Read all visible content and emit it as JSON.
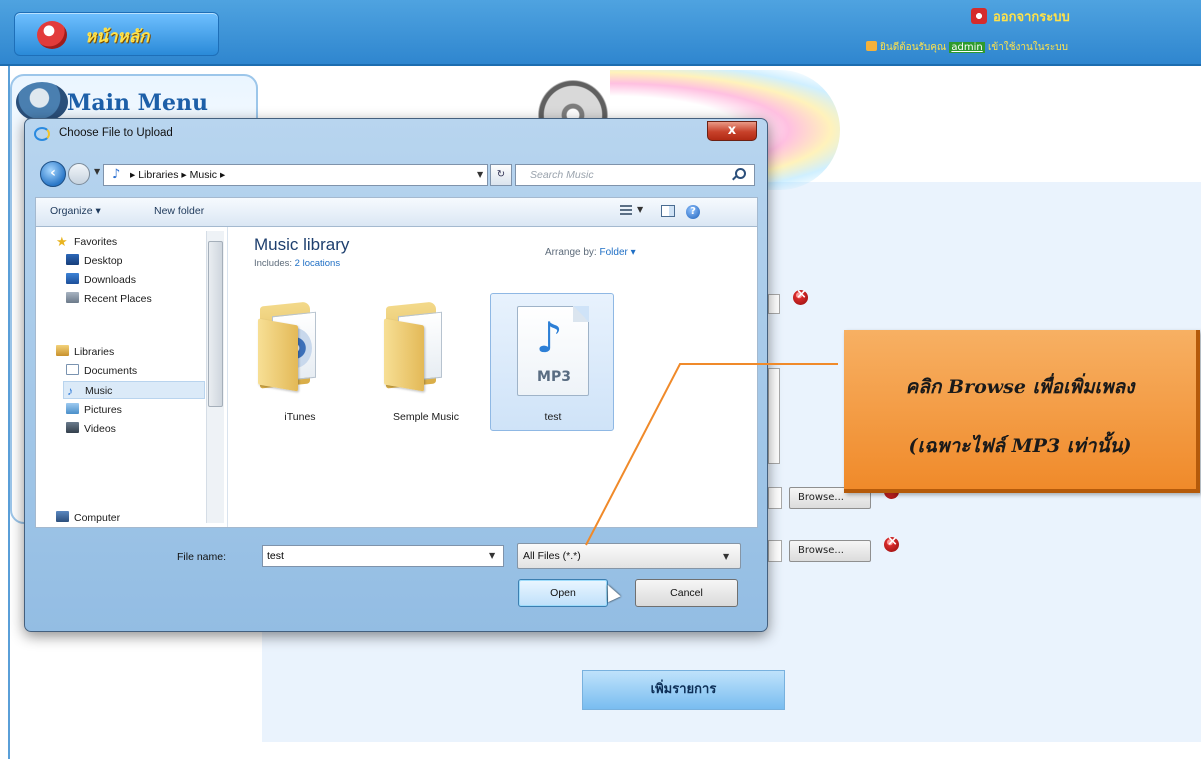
{
  "site": {
    "home_label": "หน้าหลัก",
    "logout_label": "ออกจากระบบ",
    "welcome_prefix": "ยินดีต้อนรับคุณ",
    "username": "admin",
    "welcome_suffix": "เข้าใช้งานในระบบ",
    "main_menu_title": "Main Menu",
    "browse_label": "Browse...",
    "add_item_label": "เพิ่มรายการ"
  },
  "dialog": {
    "title": "Choose File to Upload",
    "close_symbol": "x",
    "breadcrumb": [
      "Libraries",
      "Music"
    ],
    "search_placeholder": "Search Music",
    "toolbar": {
      "organize": "Organize",
      "new_folder": "New folder",
      "help": "?"
    },
    "nav_pane": [
      {
        "label": "Favorites",
        "icon": "star-icon"
      },
      {
        "label": "Desktop",
        "icon": "desktop-icon"
      },
      {
        "label": "Downloads",
        "icon": "downloads-icon"
      },
      {
        "label": "Recent Places",
        "icon": "recent-places-icon"
      },
      {
        "label": "Libraries",
        "icon": "libraries-icon"
      },
      {
        "label": "Documents",
        "icon": "documents-icon"
      },
      {
        "label": "Music",
        "icon": "music-icon",
        "selected": true
      },
      {
        "label": "Pictures",
        "icon": "pictures-icon"
      },
      {
        "label": "Videos",
        "icon": "videos-icon"
      },
      {
        "label": "Computer",
        "icon": "computer-icon"
      }
    ],
    "library": {
      "title": "Music library",
      "includes_prefix": "Includes:",
      "includes_link": "2 locations",
      "arrange_prefix": "Arrange by:",
      "arrange_value": "Folder"
    },
    "files": [
      {
        "name": "iTunes",
        "type": "folder"
      },
      {
        "name": "Semple Music",
        "type": "folder"
      },
      {
        "name": "test",
        "type": "mp3",
        "badge": "MP3",
        "selected": true
      }
    ],
    "file_name_label": "File name:",
    "file_name_value": "test",
    "file_type_value": "All Files (*.*)",
    "open_label": "Open",
    "cancel_label": "Cancel"
  },
  "callout": {
    "line1": "คลิก Browse เพื่อเพิ่มเพลง",
    "line2": "(เฉพาะไฟล์ MP3 เท่านั้น)"
  },
  "colors": {
    "header_blue": "#2f86cf",
    "callout_orange": "#f08a2a",
    "selection_blue": "#cfe3f8"
  }
}
